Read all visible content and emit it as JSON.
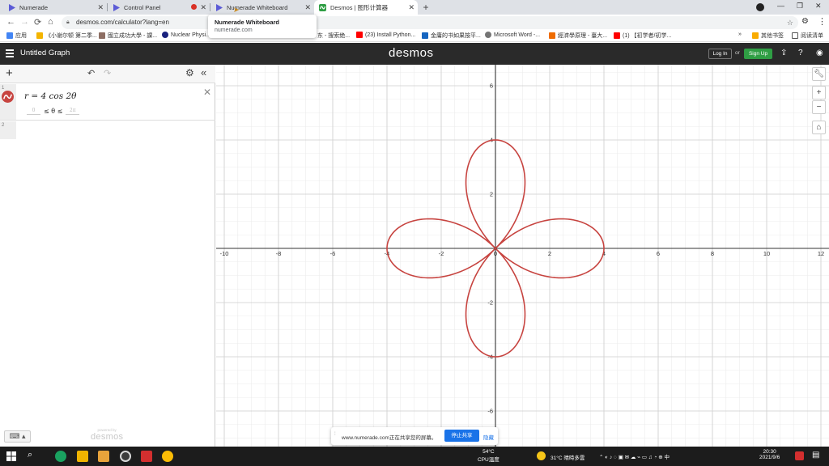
{
  "browser": {
    "tabs": [
      {
        "title": "Numerade",
        "active": false
      },
      {
        "title": "Control Panel",
        "active": false
      },
      {
        "title": "Numerade Whiteboard",
        "active": false
      },
      {
        "title": "Desmos | 图形计算器",
        "active": true
      }
    ],
    "new_tab": "+",
    "url": "desmos.com/calculator?lang=en",
    "tooltip": {
      "title": "Numerade Whiteboard",
      "url": "numerade.com"
    },
    "bookmarks": [
      {
        "label": "应用",
        "color": "#4285f4"
      },
      {
        "label": "《小谢尔顿 第二季...",
        "color": "#f4b400"
      },
      {
        "label": "國立成功大學 - 課...",
        "color": "#8d6e63"
      },
      {
        "label": "Nuclear Physi...",
        "color": "#1a237e"
      },
      {
        "label": "东 - 搜索绝...",
        "color": "#9e9e9e"
      },
      {
        "label": "(23) Install Python...",
        "color": "#ff0000"
      },
      {
        "label": "金庸的书如果按平...",
        "color": "#1565c0"
      },
      {
        "label": "Microsoft Word -...",
        "color": "#757575"
      },
      {
        "label": "經濟學原理 - 臺大...",
        "color": "#ef6c00"
      },
      {
        "label": "(1) 【初学者/初学...",
        "color": "#ff0000"
      }
    ],
    "bookmarks_more": "»",
    "other_bookmarks": "其他书签",
    "reading_list": "阅读清单"
  },
  "desmos": {
    "graph_title": "Untitled Graph",
    "logo": "desmos",
    "login": "Log In",
    "or": "or",
    "signup": "Sign Up",
    "expressions": [
      {
        "index": "1",
        "latex": "r = 4 cos 2θ",
        "theta_min": "0",
        "theta_max": "2π",
        "color": "#c74440"
      },
      {
        "index": "2",
        "latex": ""
      }
    ],
    "powered_by": "powered by",
    "powered_logo": "desmos"
  },
  "share_bar": {
    "text": "www.numerade.com正在共享您的屏幕。",
    "stop": "停止共享",
    "hide": "隐藏"
  },
  "taskbar": {
    "cpu_temp": "54°C",
    "cpu_label": "CPU温度",
    "weather": "31°C 晴時多雲",
    "time": "20:30",
    "date": "2021/9/6"
  },
  "chart_data": {
    "type": "line",
    "equation": "r = 4 cos 2θ",
    "domain_theta": [
      0,
      6.283185
    ],
    "xlim": [
      -10,
      12
    ],
    "ylim": [
      -7,
      7
    ],
    "xticks": [
      -10,
      -8,
      -6,
      -4,
      -2,
      0,
      2,
      4,
      6,
      8,
      10,
      12
    ],
    "yticks": [
      -6,
      -4,
      -2,
      2,
      4,
      6
    ],
    "grid": true,
    "series": [
      {
        "color": "#c74440"
      }
    ]
  }
}
